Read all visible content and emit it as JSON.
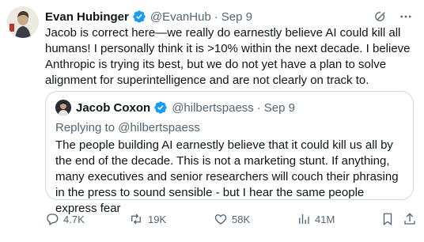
{
  "tweet": {
    "author_name": "Evan Hubinger",
    "handle": "@EvanHub",
    "date": "Sep 9",
    "separator": "·",
    "text": "Jacob is correct here—we really do earnestly believe AI could kill all humans! I personally think it is >10% within the next decade. I believe Anthropic is trying its best, but we do not yet have a plan to solve alignment for superintelligence and are not clearly on track to."
  },
  "quoted": {
    "author_name": "Jacob Coxon",
    "handle": "@hilbertspaess",
    "date": "Sep 9",
    "separator": "·",
    "replying_prefix": "Replying to",
    "replying_handle": "@hilbertspaess",
    "text": "The people building AI earnestly believe that it could kill us all by the end of the decade. This is not a marketing stunt. If anything, many executives and senior researchers will couch their phrasing in the press to sound sensible - but I hear the same people express fear"
  },
  "actions": {
    "replies": "4.7K",
    "reposts": "19K",
    "likes": "58K",
    "views": "41M"
  },
  "colors": {
    "verified": "#1d9bf0",
    "secondary_text": "#536471",
    "border": "#cfd9de"
  },
  "icons": [
    "verified-badge-icon",
    "grok-icon",
    "more-icon",
    "reply-icon",
    "repost-icon",
    "like-icon",
    "views-icon",
    "bookmark-icon",
    "share-icon"
  ]
}
